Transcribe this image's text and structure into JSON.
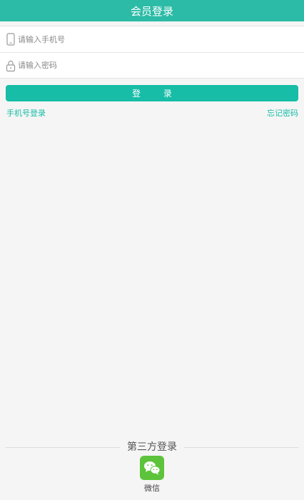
{
  "header": {
    "title": "会员登录"
  },
  "form": {
    "phone": {
      "placeholder": "请输入手机号",
      "icon": "phone-icon"
    },
    "password": {
      "placeholder": "请输入密码",
      "icon": "lock-icon"
    }
  },
  "login_button": {
    "label": "登 录"
  },
  "links": {
    "phone_login": "手机号登录",
    "forgot_password": "忘记密码"
  },
  "third_party": {
    "title": "第三方登录",
    "wechat": {
      "label": "微信",
      "icon": "wechat-icon",
      "color": "#5cc33b"
    }
  },
  "colors": {
    "accent": "#17bda6",
    "header": "#2cbba6",
    "background": "#f5f5f5"
  }
}
